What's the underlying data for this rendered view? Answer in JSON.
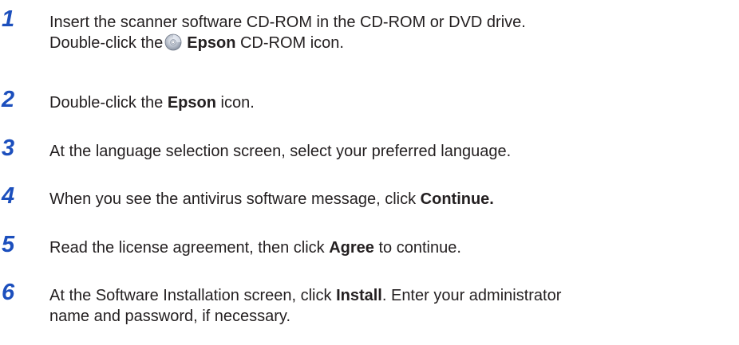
{
  "steps": [
    {
      "number": "1",
      "line1": "Insert the scanner software CD-ROM in the CD-ROM or DVD drive.",
      "line2_pre": "Double-click the",
      "line2_bold": "Epson",
      "line2_post": " CD-ROM icon.",
      "icon": "cd-rom-icon"
    },
    {
      "number": "2",
      "pre": "Double-click the ",
      "bold": "Epson",
      "post": " icon."
    },
    {
      "number": "3",
      "pre": "At the language selection screen, select your preferred language."
    },
    {
      "number": "4",
      "pre": "When you see the antivirus software message, click ",
      "bold": "Continue."
    },
    {
      "number": "5",
      "pre": "Read the license agreement, then click ",
      "bold": "Agree",
      "post": " to continue."
    },
    {
      "number": "6",
      "line1_pre": "At the Software Installation screen, click ",
      "line1_bold": "Install",
      "line1_post": ". Enter your administrator",
      "line2": "name and password, if necessary."
    }
  ],
  "colors": {
    "step_number": "#1c4fbd",
    "body_text": "#231f20"
  }
}
